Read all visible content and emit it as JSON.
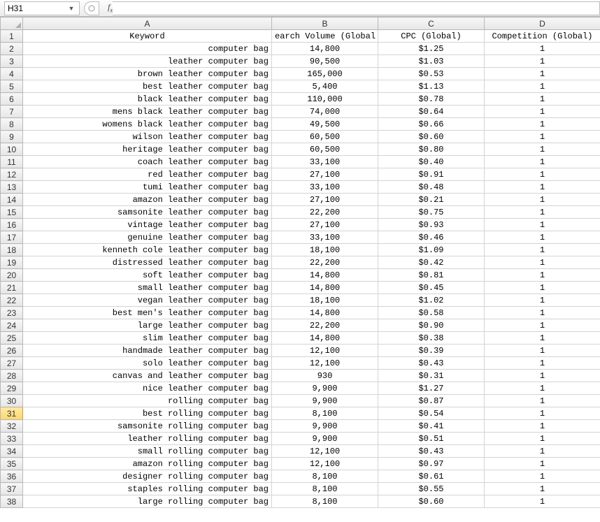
{
  "formula_bar": {
    "name_box": "H31",
    "formula_value": ""
  },
  "columns": [
    "A",
    "B",
    "C",
    "D"
  ],
  "headers": {
    "A": "Keyword",
    "B": "earch Volume (Global",
    "C": "CPC (Global)",
    "D": "Competition (Global)"
  },
  "selected_row": 31,
  "rows": [
    {
      "n": 1,
      "A": "Keyword",
      "B": "earch Volume (Global",
      "C": "CPC (Global)",
      "D": "Competition (Global)",
      "isHeader": true
    },
    {
      "n": 2,
      "A": "computer bag",
      "B": "14,800",
      "C": "$1.25",
      "D": "1"
    },
    {
      "n": 3,
      "A": "leather computer bag",
      "B": "90,500",
      "C": "$1.03",
      "D": "1"
    },
    {
      "n": 4,
      "A": "brown leather computer bag",
      "B": "165,000",
      "C": "$0.53",
      "D": "1"
    },
    {
      "n": 5,
      "A": "best leather computer bag",
      "B": "5,400",
      "C": "$1.13",
      "D": "1"
    },
    {
      "n": 6,
      "A": "black leather computer bag",
      "B": "110,000",
      "C": "$0.78",
      "D": "1"
    },
    {
      "n": 7,
      "A": "mens black leather computer bag",
      "B": "74,000",
      "C": "$0.64",
      "D": "1"
    },
    {
      "n": 8,
      "A": "womens black leather computer bag",
      "B": "49,500",
      "C": "$0.66",
      "D": "1"
    },
    {
      "n": 9,
      "A": "wilson leather computer bag",
      "B": "60,500",
      "C": "$0.60",
      "D": "1"
    },
    {
      "n": 10,
      "A": "heritage leather computer bag",
      "B": "60,500",
      "C": "$0.80",
      "D": "1"
    },
    {
      "n": 11,
      "A": "coach leather computer bag",
      "B": "33,100",
      "C": "$0.40",
      "D": "1"
    },
    {
      "n": 12,
      "A": "red leather computer bag",
      "B": "27,100",
      "C": "$0.91",
      "D": "1"
    },
    {
      "n": 13,
      "A": "tumi leather computer bag",
      "B": "33,100",
      "C": "$0.48",
      "D": "1"
    },
    {
      "n": 14,
      "A": "amazon leather computer bag",
      "B": "27,100",
      "C": "$0.21",
      "D": "1"
    },
    {
      "n": 15,
      "A": "samsonite leather computer bag",
      "B": "22,200",
      "C": "$0.75",
      "D": "1"
    },
    {
      "n": 16,
      "A": "vintage leather computer bag",
      "B": "27,100",
      "C": "$0.93",
      "D": "1"
    },
    {
      "n": 17,
      "A": "genuine leather computer bag",
      "B": "33,100",
      "C": "$0.46",
      "D": "1"
    },
    {
      "n": 18,
      "A": "kenneth cole leather computer bag",
      "B": "18,100",
      "C": "$1.09",
      "D": "1"
    },
    {
      "n": 19,
      "A": "distressed leather computer bag",
      "B": "22,200",
      "C": "$0.42",
      "D": "1"
    },
    {
      "n": 20,
      "A": "soft leather computer bag",
      "B": "14,800",
      "C": "$0.81",
      "D": "1"
    },
    {
      "n": 21,
      "A": "small leather computer bag",
      "B": "14,800",
      "C": "$0.45",
      "D": "1"
    },
    {
      "n": 22,
      "A": "vegan leather computer bag",
      "B": "18,100",
      "C": "$1.02",
      "D": "1"
    },
    {
      "n": 23,
      "A": "best men's leather computer bag",
      "B": "14,800",
      "C": "$0.58",
      "D": "1"
    },
    {
      "n": 24,
      "A": "large leather computer bag",
      "B": "22,200",
      "C": "$0.90",
      "D": "1"
    },
    {
      "n": 25,
      "A": "slim leather computer bag",
      "B": "14,800",
      "C": "$0.38",
      "D": "1"
    },
    {
      "n": 26,
      "A": "handmade leather computer bag",
      "B": "12,100",
      "C": "$0.39",
      "D": "1"
    },
    {
      "n": 27,
      "A": "solo leather computer bag",
      "B": "12,100",
      "C": "$0.43",
      "D": "1"
    },
    {
      "n": 28,
      "A": "canvas and leather computer bag",
      "B": "930",
      "C": "$0.31",
      "D": "1"
    },
    {
      "n": 29,
      "A": "nice leather computer bag",
      "B": "9,900",
      "C": "$1.27",
      "D": "1"
    },
    {
      "n": 30,
      "A": "rolling computer bag",
      "B": "9,900",
      "C": "$0.87",
      "D": "1"
    },
    {
      "n": 31,
      "A": "best rolling computer bag",
      "B": "8,100",
      "C": "$0.54",
      "D": "1"
    },
    {
      "n": 32,
      "A": "samsonite rolling computer bag",
      "B": "9,900",
      "C": "$0.41",
      "D": "1"
    },
    {
      "n": 33,
      "A": "leather rolling computer bag",
      "B": "9,900",
      "C": "$0.51",
      "D": "1"
    },
    {
      "n": 34,
      "A": "small rolling computer bag",
      "B": "12,100",
      "C": "$0.43",
      "D": "1"
    },
    {
      "n": 35,
      "A": "amazon rolling computer bag",
      "B": "12,100",
      "C": "$0.97",
      "D": "1"
    },
    {
      "n": 36,
      "A": "designer rolling computer bag",
      "B": "8,100",
      "C": "$0.61",
      "D": "1"
    },
    {
      "n": 37,
      "A": "staples rolling computer bag",
      "B": "8,100",
      "C": "$0.55",
      "D": "1"
    },
    {
      "n": 38,
      "A": "large rolling computer bag",
      "B": "8,100",
      "C": "$0.60",
      "D": "1"
    }
  ]
}
